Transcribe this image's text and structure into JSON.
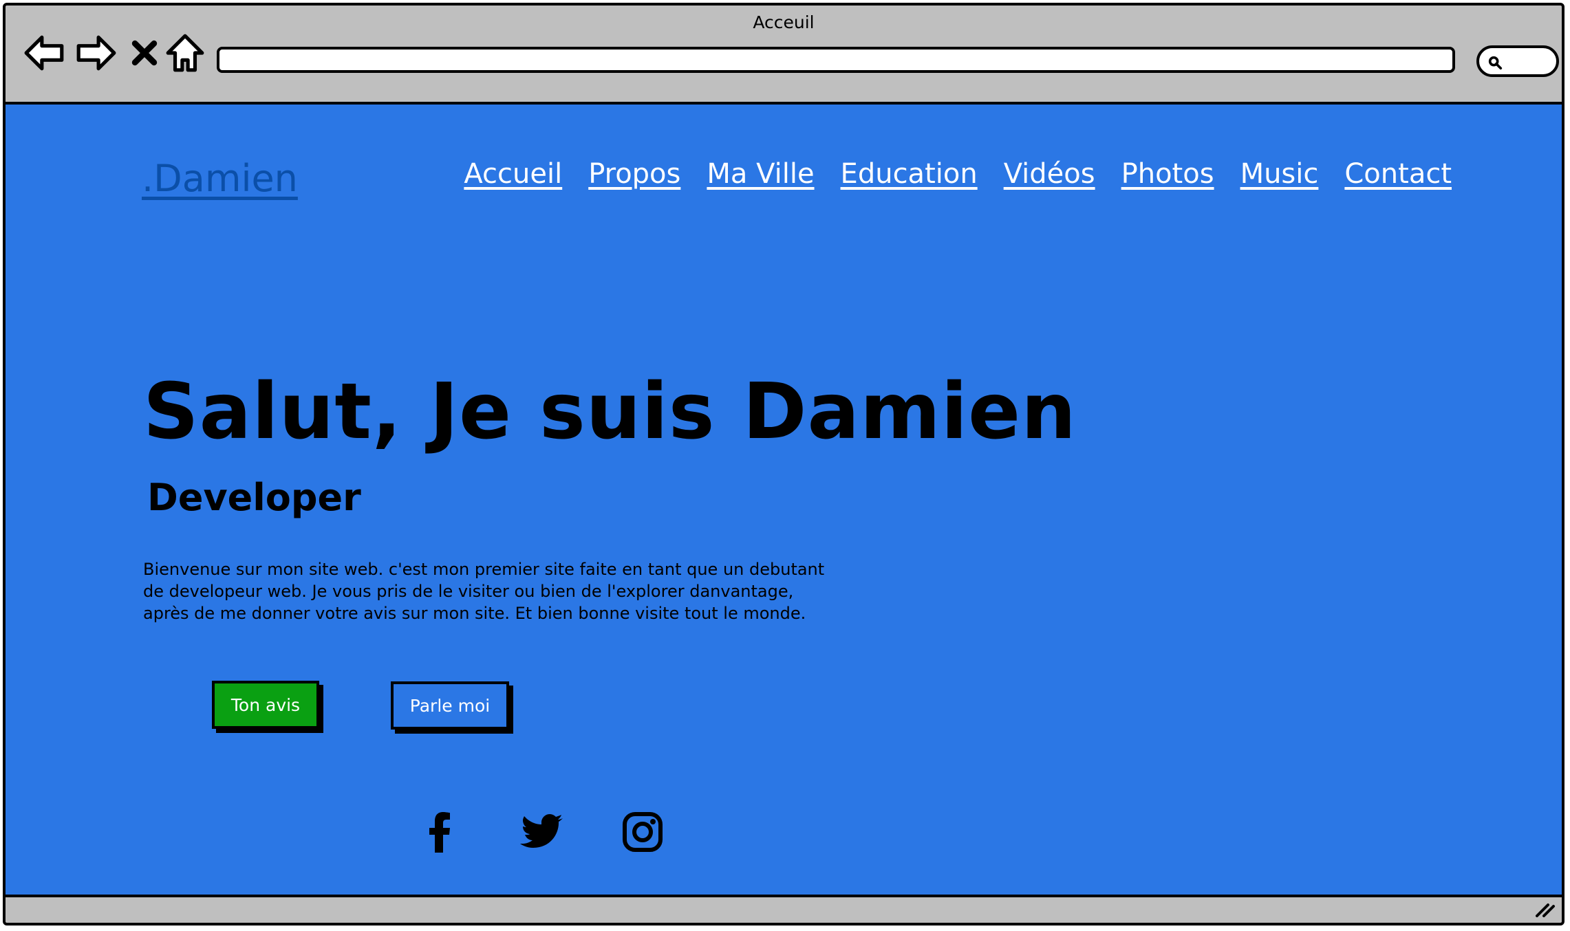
{
  "window": {
    "title": "Acceuil"
  },
  "toolbar": {
    "icons": [
      "back-arrow-icon",
      "forward-arrow-icon",
      "close-icon",
      "home-icon",
      "search-icon"
    ],
    "url_value": ""
  },
  "site": {
    "brand": ".Damien",
    "nav": [
      "Accueil",
      "Propos",
      "Ma Ville",
      "Education",
      "Vidéos",
      "Photos",
      "Music",
      "Contact"
    ]
  },
  "hero": {
    "title": "Salut, Je suis Damien",
    "subtitle": "Developer",
    "text": "Bienvenue sur mon site web. c'est mon premier site faite en tant que un debutant de developeur web. Je vous pris de le visiter ou bien de l'explorer danvantage, après de me donner votre avis sur mon site. Et bien bonne visite tout le monde.",
    "buttons": {
      "primary": "Ton avis",
      "secondary": "Parle moi"
    }
  },
  "social": [
    "facebook-icon",
    "twitter-icon",
    "instagram-icon"
  ],
  "colors": {
    "page_background": "#2b77e5",
    "brand": "#0b4fa8",
    "primary_button": "#0aa012",
    "chrome": "#bfbfbf"
  }
}
